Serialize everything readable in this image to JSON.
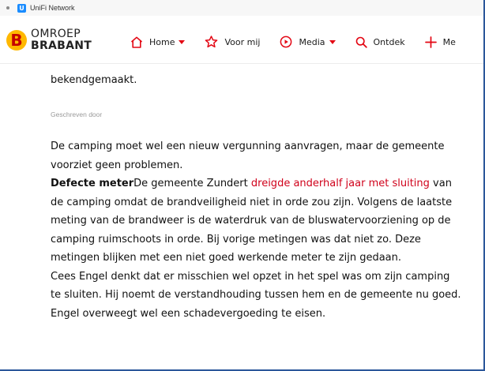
{
  "bookmark": {
    "icon_letter": "U",
    "label": "UniFi Network"
  },
  "logo": {
    "mark": "B",
    "line1": "OMROEP",
    "line2": "BRABANT"
  },
  "nav": {
    "items": [
      {
        "label": "Home",
        "icon": "house-icon",
        "has_caret": true
      },
      {
        "label": "Voor mij",
        "icon": "star-icon",
        "has_caret": false
      },
      {
        "label": "Media",
        "icon": "play-circle-icon",
        "has_caret": true
      },
      {
        "label": "Ontdek",
        "icon": "search-icon",
        "has_caret": false
      },
      {
        "label": "Me",
        "icon": "plus-icon",
        "has_caret": false
      }
    ],
    "accent_color": "#e30613"
  },
  "article": {
    "lead_tail": "bekendgemaakt.",
    "byline": "Geschreven door",
    "paragraph1": "De camping moet wel een nieuw vergunning aanvragen, maar de gemeente voorziet geen problemen.",
    "heading": "Defecte meter",
    "p2_before_link": "De gemeente Zundert ",
    "p2_link": "dreigde anderhalf jaar met sluiting",
    "p2_after_link": " van de camping omdat de brandveiligheid niet in orde zou zijn. Volgens de laatste meting van de brandweer is de waterdruk van de bluswatervoorziening op de camping ruimschoots in orde. Bij vorige metingen was dat niet zo. Deze metingen blijken met een niet goed werkende meter te zijn gedaan.",
    "paragraph3": "Cees Engel denkt dat er misschien wel opzet in het spel was om zijn camping te sluiten. Hij noemt de verstandhouding tussen hem en de gemeente nu goed. Engel overweegt wel een schadevergoeding te eisen.",
    "link_color": "#d0021b"
  }
}
